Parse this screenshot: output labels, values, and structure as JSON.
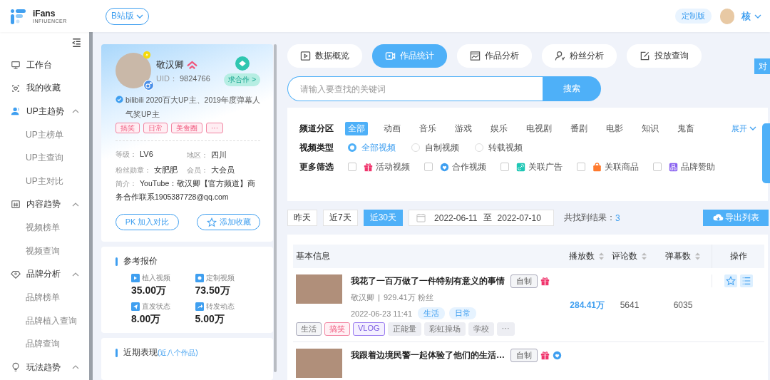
{
  "header": {
    "logo": {
      "name": "iFans",
      "subtitle": "INFIUENCER"
    },
    "version_select": "B站版",
    "custom_badge": "定制版",
    "user_name": "核"
  },
  "sidebar": {
    "items": [
      {
        "kind": "item",
        "label": "工作台",
        "selected": false
      },
      {
        "kind": "item",
        "label": "我的收藏",
        "selected": false
      },
      {
        "kind": "group",
        "label": "UP主趋势",
        "selected": true,
        "expanded": true,
        "children": [
          {
            "label": "UP主榜单"
          },
          {
            "label": "UP主查询"
          },
          {
            "label": "UP主对比"
          }
        ]
      },
      {
        "kind": "group",
        "label": "内容趋势",
        "selected": false,
        "expanded": true,
        "children": [
          {
            "label": "视频榜单"
          },
          {
            "label": "视频查询"
          }
        ]
      },
      {
        "kind": "group",
        "label": "品牌分析",
        "selected": false,
        "expanded": true,
        "children": [
          {
            "label": "品牌榜单"
          },
          {
            "label": "品牌植入查询"
          },
          {
            "label": "品牌查询"
          }
        ]
      },
      {
        "kind": "group",
        "label": "玩法趋势",
        "selected": false,
        "expanded": true
      }
    ]
  },
  "profile": {
    "name": "敬汉卿",
    "uid_label": "UID：",
    "uid": "9824766",
    "cooperate": "求合作 >",
    "verification": "bilibili 2020百大UP主、2019年度弹幕人气奖UP主",
    "tags": [
      "搞笑",
      "日常",
      "美食圈",
      "···"
    ],
    "stats": [
      {
        "label": "等级：",
        "value": "LV6"
      },
      {
        "label": "地区：",
        "value": "四川"
      },
      {
        "label": "粉丝勋章：",
        "value": "女肥肥"
      },
      {
        "label": "会员：",
        "value": "大会员"
      }
    ],
    "intro_label": "简介：",
    "intro": "YouTube：敬汉卿【官方频道】商务合作联系1905387728@qq.com",
    "buttons": [
      {
        "kind": "pk",
        "label": "PK 加入对比"
      },
      {
        "kind": "favorite",
        "label": "添加收藏"
      }
    ]
  },
  "quote": {
    "title": "参考报价",
    "items": [
      {
        "kind": "video",
        "label": "植入视频",
        "value": "35.00万"
      },
      {
        "kind": "custom",
        "label": "定制视频",
        "value": "73.50万"
      },
      {
        "kind": "send",
        "label": "直发状态",
        "value": "8.00万"
      },
      {
        "kind": "share",
        "label": "转发动态",
        "value": "5.00万"
      }
    ]
  },
  "recent": {
    "title": "近期表现",
    "note": "(近八个作品)"
  },
  "tabs": [
    {
      "label": "数据概览",
      "selected": false
    },
    {
      "label": "作品统计",
      "selected": true
    },
    {
      "label": "作品分析",
      "selected": false
    },
    {
      "label": "粉丝分析",
      "selected": false
    },
    {
      "label": "投放查询",
      "selected": false
    }
  ],
  "search": {
    "placeholder": "请输入要查找的关键词",
    "button": "搜索"
  },
  "filters": {
    "channel": {
      "label": "频道分区",
      "expand": "展开",
      "options": [
        {
          "label": "全部",
          "selected": true
        },
        {
          "label": "动画",
          "selected": false
        },
        {
          "label": "音乐",
          "selected": false
        },
        {
          "label": "游戏",
          "selected": false
        },
        {
          "label": "娱乐",
          "selected": false
        },
        {
          "label": "电视剧",
          "selected": false
        },
        {
          "label": "番剧",
          "selected": false
        },
        {
          "label": "电影",
          "selected": false
        },
        {
          "label": "知识",
          "selected": false
        },
        {
          "label": "鬼畜",
          "selected": false
        }
      ]
    },
    "type": {
      "label": "视频类型",
      "options": [
        {
          "label": "全部视频",
          "selected": true
        },
        {
          "label": "自制视频",
          "selected": false
        },
        {
          "label": "转载视频",
          "selected": false
        }
      ]
    },
    "more": {
      "label": "更多筛选",
      "options": [
        {
          "kind": "gift",
          "label": "活动视频",
          "checked": false
        },
        {
          "kind": "heart",
          "label": "合作视频",
          "checked": false
        },
        {
          "kind": "link",
          "label": "关联广告",
          "checked": false
        },
        {
          "kind": "bag",
          "label": "关联商品",
          "checked": false
        },
        {
          "kind": "brand",
          "label": "品牌赞助",
          "checked": false
        }
      ]
    }
  },
  "date_bar": {
    "quick": [
      {
        "label": "昨天",
        "selected": false
      },
      {
        "label": "近7天",
        "selected": false
      },
      {
        "label": "近30天",
        "selected": true
      }
    ],
    "start": "2022-06-11",
    "separator": "至",
    "end": "2022-07-10",
    "result_label": "共找到结果：",
    "result_count": "3",
    "export": "导出列表"
  },
  "table": {
    "columns": [
      {
        "label": "基本信息",
        "sortable": false
      },
      {
        "label": "播放数",
        "sortable": true
      },
      {
        "label": "评论数",
        "sortable": true
      },
      {
        "label": "弹幕数",
        "sortable": true
      },
      {
        "label": "操作",
        "sortable": false
      }
    ],
    "rows": [
      {
        "title": "我花了一百万做了一件特别有意义的事情",
        "badge": "自制",
        "activity": true,
        "cooperation": false,
        "author": "敬汉卿",
        "fans": "929.41万 粉丝",
        "date": "2022-06-23 11:41",
        "categories": [
          "生活",
          "日常"
        ],
        "tags": [
          {
            "kind": "outline",
            "label": "生活"
          },
          {
            "kind": "pink",
            "label": "搞笑"
          },
          {
            "kind": "purple",
            "label": "VLOG"
          },
          {
            "kind": "fill",
            "label": "正能量"
          },
          {
            "kind": "fill",
            "label": "彩虹操场"
          },
          {
            "kind": "fill",
            "label": "学校"
          },
          {
            "kind": "fill",
            "label": "···"
          }
        ],
        "plays": "284.41万",
        "comments": "5641",
        "danmaku": "6035"
      },
      {
        "title": "我跟着边境民警一起体验了他们的生活…",
        "badge": "自制",
        "activity": true,
        "cooperation": true
      }
    ]
  },
  "side_tab": "对"
}
